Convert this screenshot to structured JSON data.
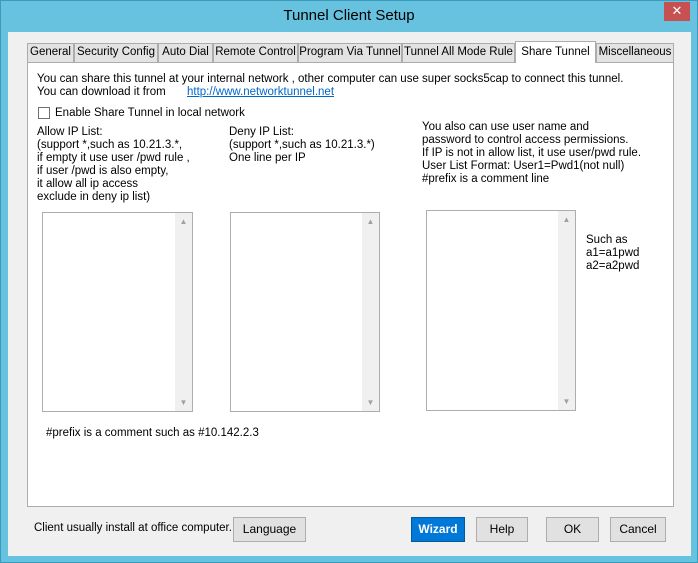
{
  "window": {
    "title": "Tunnel Client Setup",
    "close_glyph": "✕"
  },
  "tabs": [
    {
      "label": "General"
    },
    {
      "label": "Security Config"
    },
    {
      "label": "Auto Dial"
    },
    {
      "label": "Remote Control"
    },
    {
      "label": "Program Via Tunnel"
    },
    {
      "label": "Tunnel All Mode Rule"
    },
    {
      "label": "Share Tunnel"
    },
    {
      "label": "Miscellaneous"
    }
  ],
  "share_tunnel": {
    "intro_line1": "You can share this tunnel at your internal network , other computer can use super socks5cap to connect this tunnel.",
    "intro_line2": "You can download it from",
    "download_link": "http://www.networktunnel.net",
    "enable_label": "Enable Share Tunnel in local network",
    "allow": {
      "lines": [
        "Allow IP List:",
        "(support *,such as 10.21.3.*,",
        "if empty it use user /pwd rule ,",
        "if user /pwd is also empty,",
        "it allow all ip access",
        "exclude in deny ip list)"
      ]
    },
    "deny": {
      "lines": [
        "Deny IP List:",
        "(support *,such as 10.21.3.*)",
        "One line per IP"
      ]
    },
    "users": {
      "lines": [
        "You also can use user name and",
        "password to control access permissions.",
        "If IP is not in allow list, it use user/pwd rule.",
        "User List Format:   User1=Pwd1(not null)",
        "#prefix is a comment line"
      ],
      "example_lines": [
        "Such as",
        "a1=a1pwd",
        "a2=a2pwd"
      ]
    },
    "comment_note": "#prefix is a comment such as #10.142.2.3"
  },
  "footer": {
    "note": "Client usually install at office computer.",
    "language": "Language",
    "wizard": "Wizard",
    "help": "Help",
    "ok": "OK",
    "cancel": "Cancel"
  },
  "colors": {
    "frame": "#66c2df",
    "close": "#c75050",
    "primary_button": "#0078d7",
    "link": "#0066cc"
  }
}
